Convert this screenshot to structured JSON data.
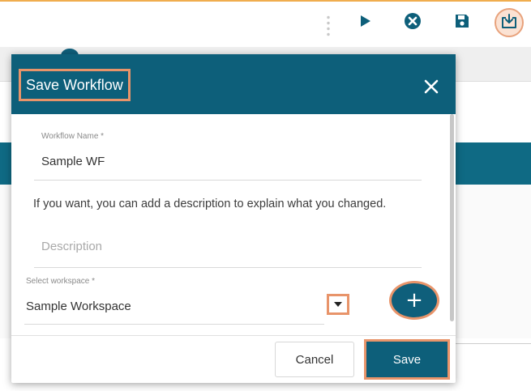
{
  "colors": {
    "brand_teal": "#0d5f7a",
    "highlight_orange": "#e8946a",
    "top_accent": "#f0ad4e"
  },
  "toolbar": {
    "icons": [
      "play-icon",
      "stop-icon",
      "save-icon",
      "download-icon"
    ]
  },
  "modal": {
    "title": "Save Workflow",
    "close_icon": "close-icon",
    "workflow_name": {
      "label": "Workflow Name *",
      "value": "Sample WF"
    },
    "info_text": "If you want, you can add a description to explain what you changed.",
    "description": {
      "placeholder": "Description"
    },
    "workspace": {
      "label": "Select workspace *",
      "value": "Sample Workspace",
      "dropdown_icon": "caret-down-icon",
      "add_icon": "plus-icon",
      "add_label": "+"
    },
    "buttons": {
      "cancel": "Cancel",
      "save": "Save"
    }
  }
}
